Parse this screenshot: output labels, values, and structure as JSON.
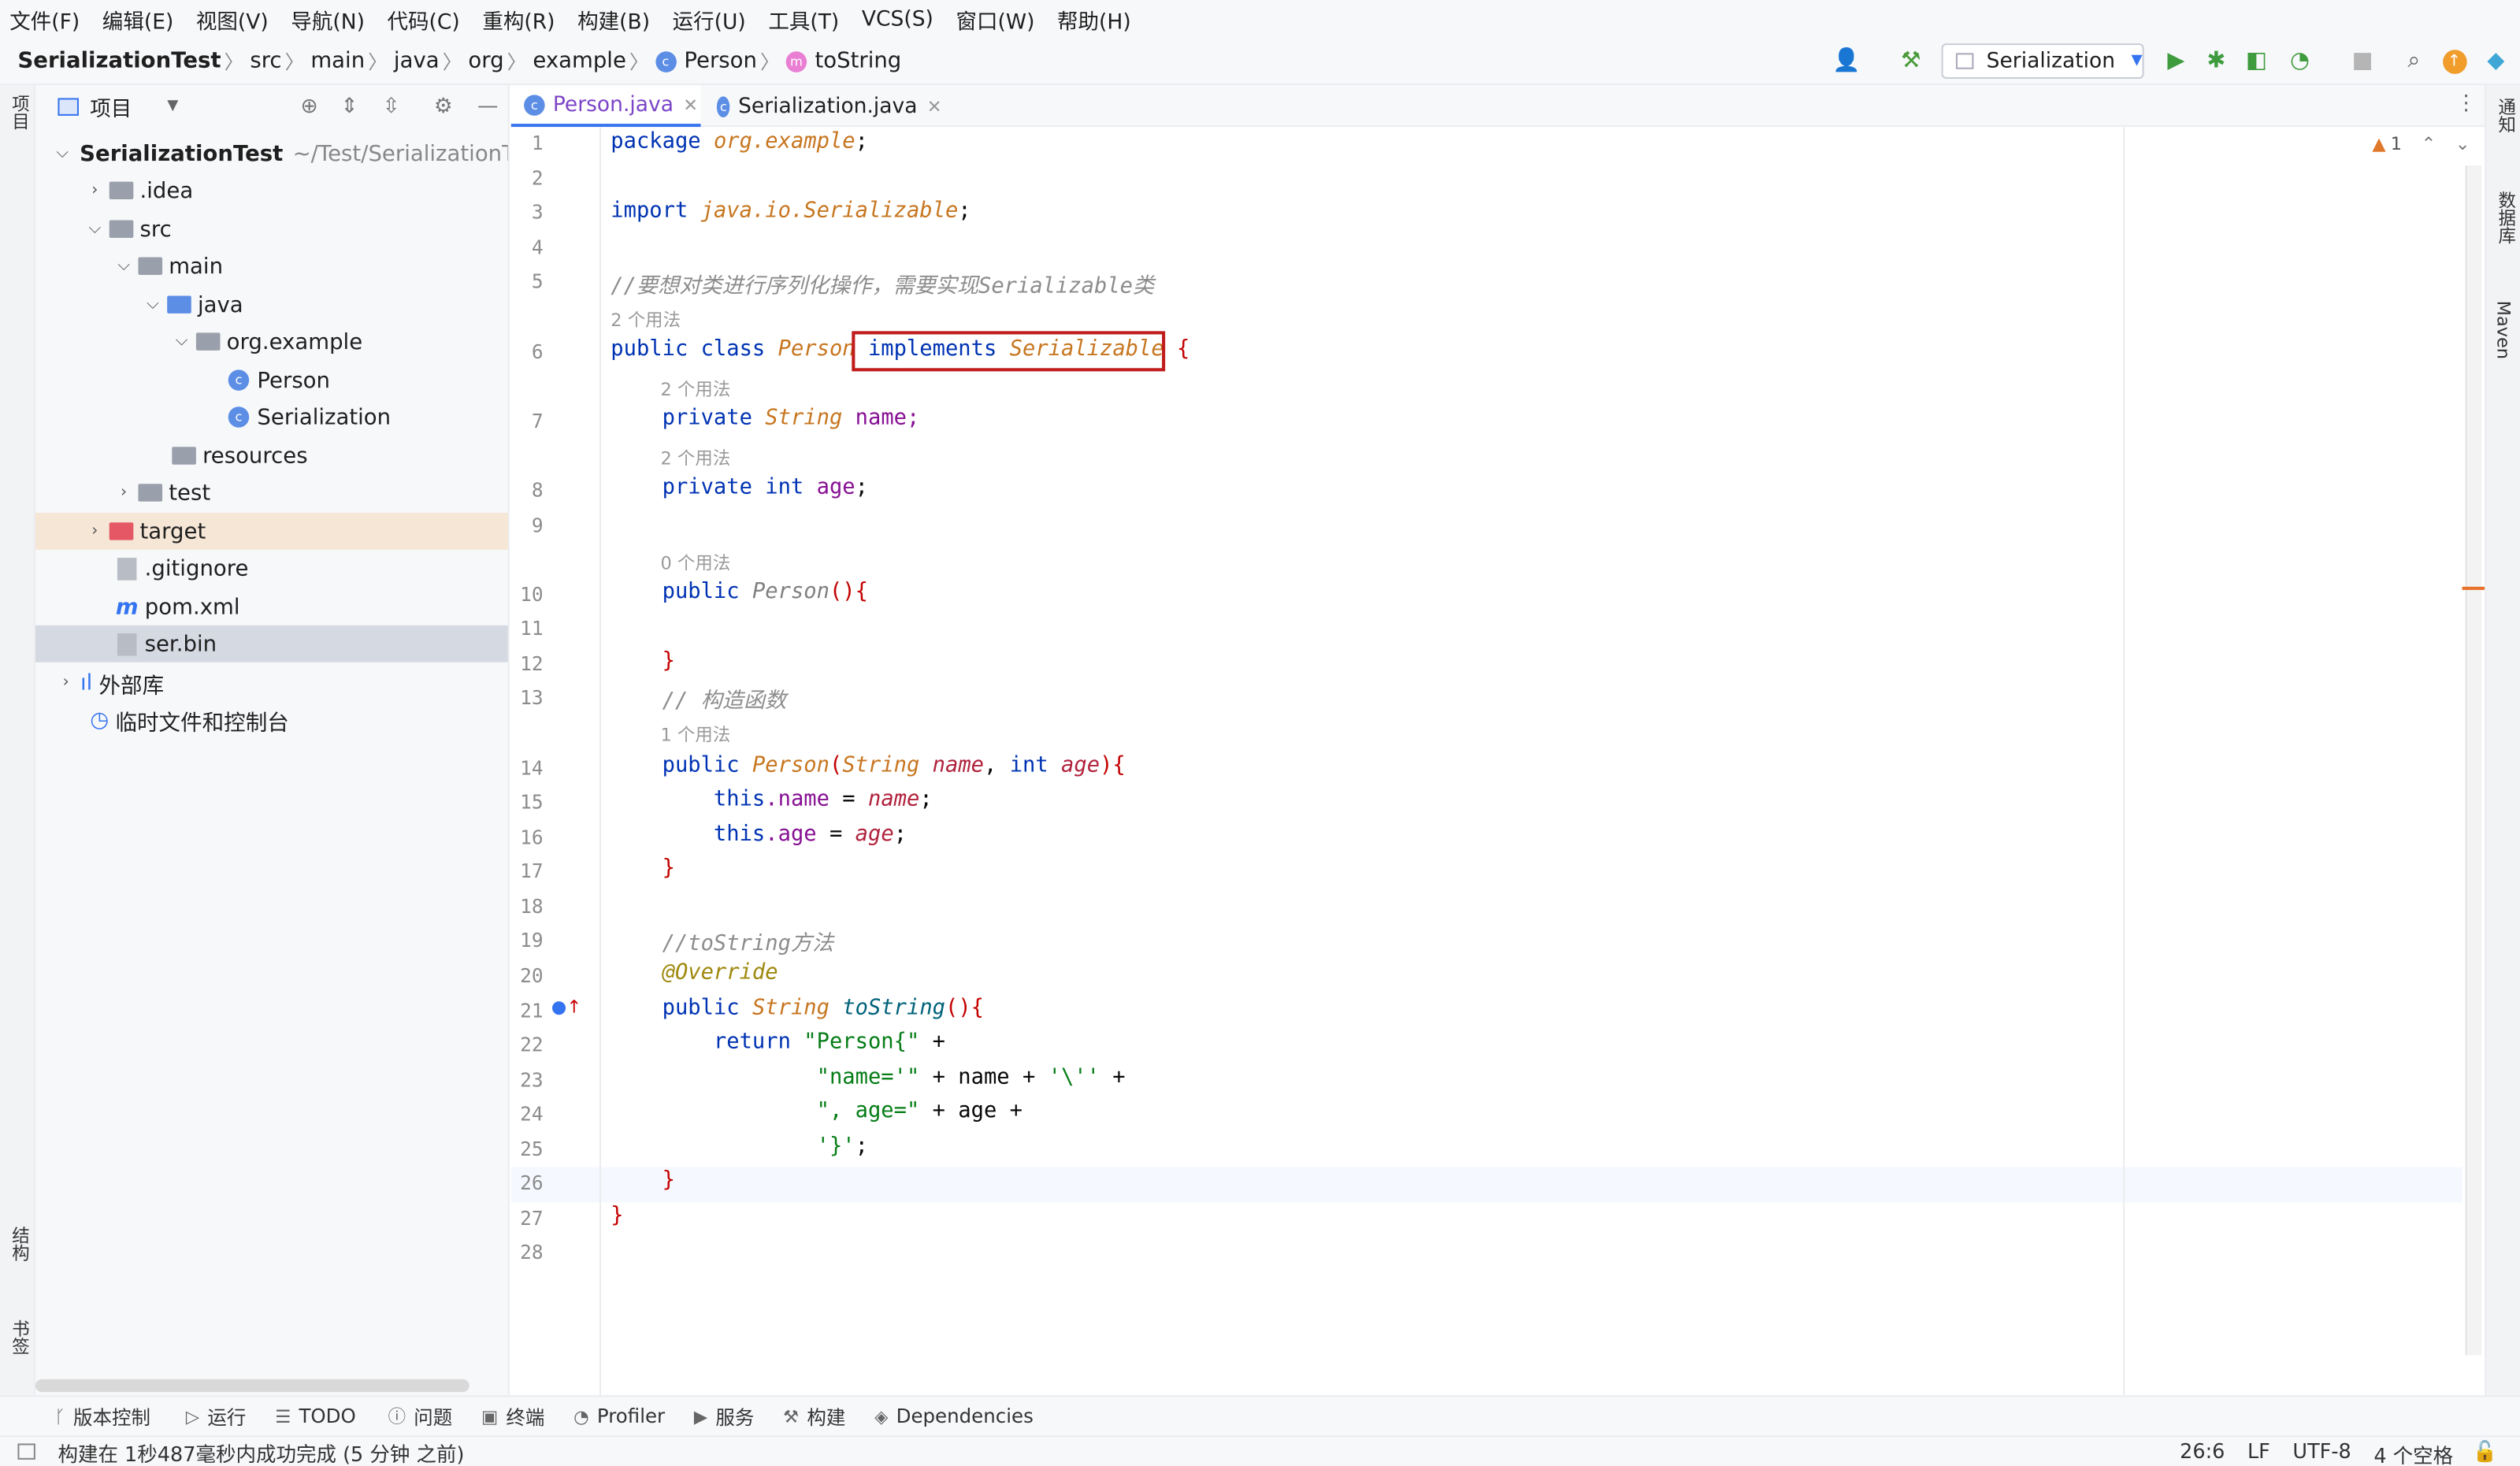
{
  "menu": [
    "文件(F)",
    "编辑(E)",
    "视图(V)",
    "导航(N)",
    "代码(C)",
    "重构(R)",
    "构建(B)",
    "运行(U)",
    "工具(T)",
    "VCS(S)",
    "窗口(W)",
    "帮助(H)"
  ],
  "breadcrumb": {
    "project": "SerializationTest",
    "parts": [
      "src",
      "main",
      "java",
      "org",
      "example"
    ],
    "class": "Person",
    "method": "toString"
  },
  "toolbar": {
    "run_config": "Serialization"
  },
  "left_strip": {
    "project": "项目",
    "structure": "结构",
    "bookmarks": "书签"
  },
  "right_strip": {
    "notifications": "通知",
    "database": "数据库",
    "maven": "Maven"
  },
  "project_panel": {
    "title": "项目",
    "root": {
      "name": "SerializationTest",
      "path": "~/Test/SerializationTe"
    },
    "items": {
      "idea": ".idea",
      "src": "src",
      "main": "main",
      "java": "java",
      "pkg": "org.example",
      "person": "Person",
      "serialization": "Serialization",
      "resources": "resources",
      "test": "test",
      "target": "target",
      "gitignore": ".gitignore",
      "pom": "pom.xml",
      "serbin": "ser.bin",
      "extlib": "外部库",
      "scratch": "临时文件和控制台"
    }
  },
  "tabs": [
    {
      "label": "Person.java"
    },
    {
      "label": "Serialization.java"
    }
  ],
  "inspection": {
    "warnings": "1"
  },
  "hints": {
    "u2": "2 个用法",
    "u0": "0 个用法",
    "u1": "1 个用法"
  },
  "line_numbers": [
    "1",
    "2",
    "3",
    "4",
    "5",
    "6",
    "7",
    "8",
    "9",
    "10",
    "11",
    "12",
    "13",
    "14",
    "15",
    "16",
    "17",
    "18",
    "19",
    "20",
    "21",
    "22",
    "23",
    "24",
    "25",
    "26",
    "27",
    "28"
  ],
  "code": {
    "l1a": "package ",
    "l1b": "org.example",
    "l1c": ";",
    "l3a": "import ",
    "l3b": "java.io.Serializable",
    "l3c": ";",
    "l5": "//要想对类进行序列化操作，需要实现Serializable类",
    "l6a": "public class ",
    "l6b": "Person",
    "l6c": " implements ",
    "l6d": "Serializable",
    "l6e": " {",
    "l7a": "    private ",
    "l7b": "String",
    "l7c": " name;",
    "l8a": "    private int ",
    "l8b": "age",
    "l8c": ";",
    "l10a": "    public ",
    "l10b": "Person",
    "l10c": "(){",
    "l12": "    }",
    "l13": "    // 构造函数",
    "l14a": "    public ",
    "l14b": "Person",
    "l14c": "(",
    "l14d": "String",
    "l14e": " name",
    "l14f": ", ",
    "l14g": "int",
    "l14h": " age",
    "l14i": "){",
    "l15a": "        this",
    "l15b": ".name",
    "l15c": " = ",
    "l15d": "name",
    "l15e": ";",
    "l16a": "        this",
    "l16b": ".age",
    "l16c": " = ",
    "l16d": "age",
    "l16e": ";",
    "l17": "    }",
    "l19": "    //toString方法",
    "l20": "    @Override",
    "l21a": "    public ",
    "l21b": "String",
    "l21c": " ",
    "l21d": "toString",
    "l21e": "(){",
    "l22a": "        return ",
    "l22b": "\"Person{\"",
    "l22c": " +",
    "l23a": "                ",
    "l23b": "\"name='\"",
    "l23c": " + name + ",
    "l23d": "'\\''",
    "l23e": " +",
    "l24a": "                ",
    "l24b": "\", age=\"",
    "l24c": " + age +",
    "l25a": "                ",
    "l25b": "'}'",
    "l25c": ";",
    "l26": "    }",
    "l27": "}"
  },
  "tool_windows": [
    "版本控制",
    "运行",
    "TODO",
    "问题",
    "终端",
    "Profiler",
    "服务",
    "构建",
    "Dependencies"
  ],
  "status": {
    "message": "构建在 1秒487毫秒内成功完成 (5 分钟 之前)",
    "position": "26:6",
    "line_sep": "LF",
    "encoding": "UTF-8",
    "indent": "4 个空格"
  }
}
